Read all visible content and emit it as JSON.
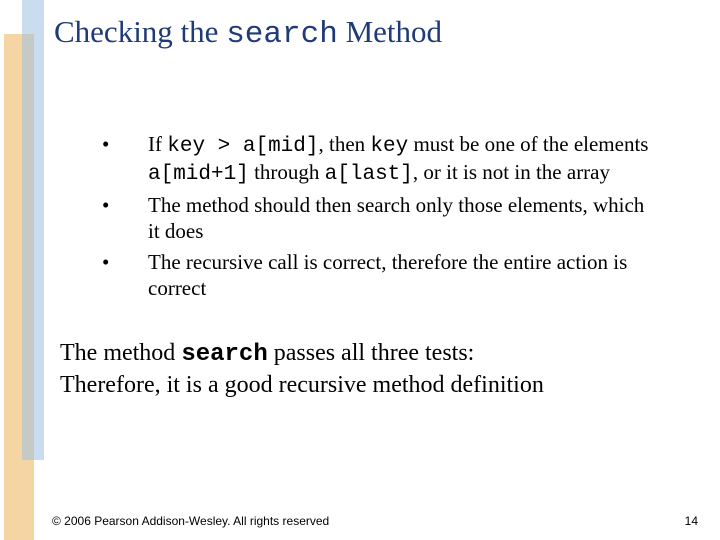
{
  "title": {
    "pre": "Checking the ",
    "code": "search",
    "post": " Method"
  },
  "bullets": [
    {
      "mark": "•",
      "parts": [
        {
          "t": "If ",
          "c": false
        },
        {
          "t": "key > a[mid]",
          "c": true
        },
        {
          "t": ", then ",
          "c": false
        },
        {
          "t": "key",
          "c": true
        },
        {
          "t": " must be one of the elements ",
          "c": false
        },
        {
          "t": "a[mid+1]",
          "c": true
        },
        {
          "t": " through ",
          "c": false
        },
        {
          "t": "a[last]",
          "c": true
        },
        {
          "t": ", or it is not in the array",
          "c": false
        }
      ]
    },
    {
      "mark": "•",
      "parts": [
        {
          "t": "The method should then search only those elements, which it does",
          "c": false
        }
      ]
    },
    {
      "mark": "•",
      "parts": [
        {
          "t": "The recursive call is correct, therefore the entire action is correct",
          "c": false
        }
      ]
    }
  ],
  "conclusion": {
    "line1_pre": "The method ",
    "line1_code": "search",
    "line1_post": " passes all three tests:",
    "line2": "Therefore, it is a good recursive method definition"
  },
  "footer": {
    "copyright": "© 2006 Pearson Addison-Wesley. All rights reserved",
    "page": "14"
  }
}
